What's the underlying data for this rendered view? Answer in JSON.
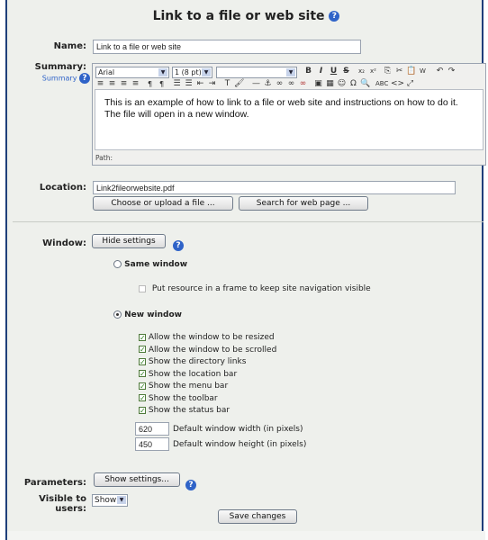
{
  "title": "Link to a file or web site",
  "name": {
    "label": "Name:",
    "value": "Link to a file or web site"
  },
  "summary": {
    "label": "Summary:",
    "sublabel": "Summary",
    "font": "Arial",
    "size": "1 (8 pt)",
    "content": "This is an example of how to link to a file or web site and instructions on how to do it.  The file will open in a new window.",
    "path_label": "Path:"
  },
  "location": {
    "label": "Location:",
    "value": "Link2fileorwebsite.pdf",
    "upload_button": "Choose or upload a file ...",
    "search_button": "Search for web page ..."
  },
  "window": {
    "label": "Window:",
    "hide_button": "Hide settings",
    "same_window": "Same window",
    "frame_option": "Put resource in a frame to keep site navigation visible",
    "new_window": "New window",
    "options": [
      "Allow the window to be resized",
      "Allow the window to be scrolled",
      "Show the directory links",
      "Show the location bar",
      "Show the menu bar",
      "Show the toolbar",
      "Show the status bar"
    ],
    "width_value": "620",
    "width_label": "Default window width (in pixels)",
    "height_value": "450",
    "height_label": "Default window height (in pixels)"
  },
  "parameters": {
    "label": "Parameters:",
    "button": "Show settings..."
  },
  "visible": {
    "label": "Visible to users:",
    "value": "Show"
  },
  "save_button": "Save changes",
  "colors": {
    "accent": "#1f3f7a",
    "help": "#2f63c8",
    "panel": "#eef0ec"
  },
  "icons": [
    "help-icon",
    "bold-icon",
    "italic-icon",
    "underline-icon",
    "strike-icon",
    "undo-icon",
    "redo-icon",
    "check-icon"
  ]
}
